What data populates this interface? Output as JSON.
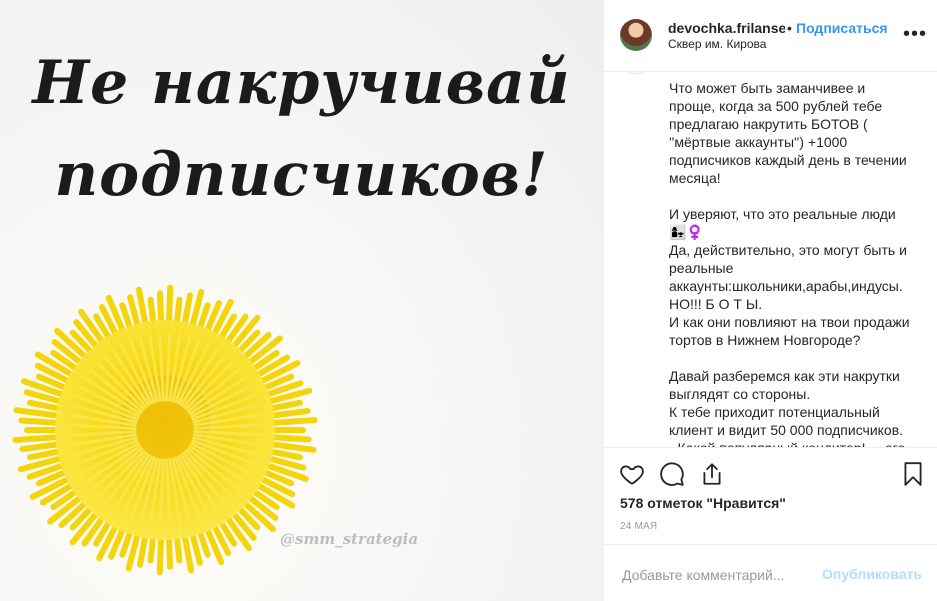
{
  "media": {
    "headline_line1": "Не накручивай",
    "headline_line2": "подписчиков!",
    "watermark": "@smm_strategia",
    "flower_color": "#f6d60c"
  },
  "header": {
    "username": "devochka.frilanser",
    "dot": "•",
    "follow_label": "Подписаться",
    "location": "Сквер им. Кирова",
    "more_icon": "more-horizontal-icon"
  },
  "caption": {
    "text": "Что может быть заманчивее и\nпроще, когда за 500 рублей тебе\nпредлагаю накрутить БОТОВ (\n''мёртвые аккаунты'') +1000\nподписчиков каждый день в течении\nмесяца!\n\nИ уверяют, что это реальные люди\n👩‍👧‍♀️\nДа, действительно, это могут быть и\nреальные\nаккаунты:школьники,арабы,индусы.\nНО!!! Б О Т Ы.\nИ как они повлияют на твои продажи\nтортов в Нижнем Новгороде?\n\nДавай разберемся как эти накрутки\nвыглядят со стороны.\nК тебе приходит потенциальный\nклиент и видит 50 000 подписчиков.\n- Какой популярный кондитер!.... его"
  },
  "actions": {
    "like_icon": "heart-icon",
    "comment_icon": "comment-icon",
    "share_icon": "share-icon",
    "save_icon": "bookmark-icon"
  },
  "likes_text": "578 отметок \"Нравится\"",
  "date_text": "24 МАЯ",
  "add_comment": {
    "placeholder": "Добавьте комментарий...",
    "publish_label": "Опубликовать"
  },
  "colors": {
    "accent": "#3897f0",
    "publish_disabled": "#b2dffc",
    "text": "#262626",
    "muted": "#999999"
  }
}
